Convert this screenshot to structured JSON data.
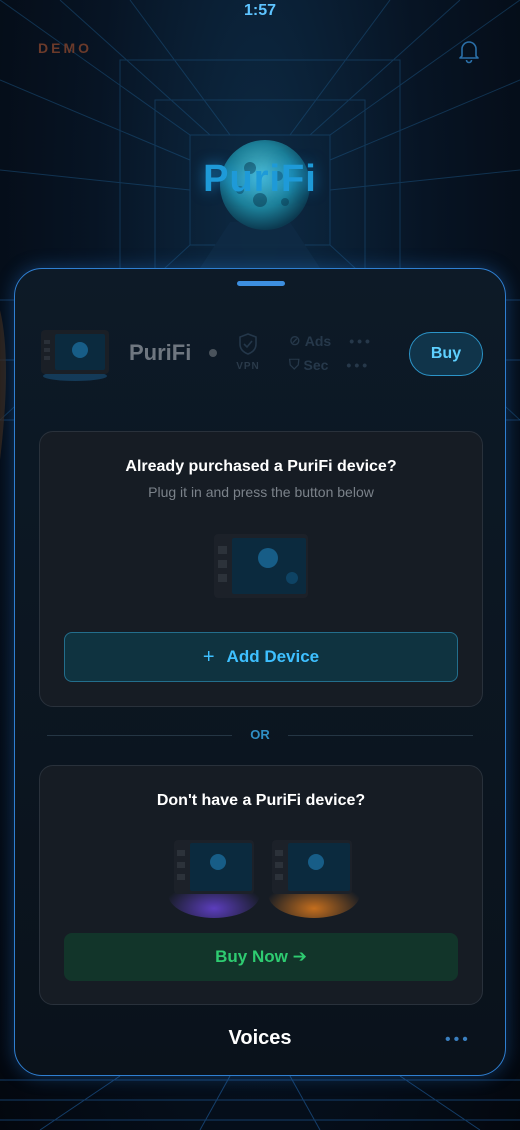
{
  "status_bar": {
    "time": "1:57"
  },
  "header": {
    "demo_label": "DEMO",
    "brand": "PuriFi"
  },
  "device_row": {
    "name": "PuriFi",
    "vpn_label": "VPN",
    "ads_label": "Ads",
    "sec_label": "Sec",
    "buy_label": "Buy"
  },
  "existing_card": {
    "title": "Already purchased a PuriFi device?",
    "subtitle": "Plug it in and press the button below",
    "add_label": "Add Device",
    "add_icon": "+"
  },
  "divider": {
    "label": "OR"
  },
  "new_card": {
    "title": "Don't have a PuriFi device?",
    "buy_label": "Buy Now ➔"
  },
  "footer": {
    "label": "Voices"
  },
  "colors": {
    "accent": "#3ec0ff",
    "sheet_border": "#2f7fd1",
    "buy_green": "#2ecc71",
    "card_bg": "#161c24"
  }
}
